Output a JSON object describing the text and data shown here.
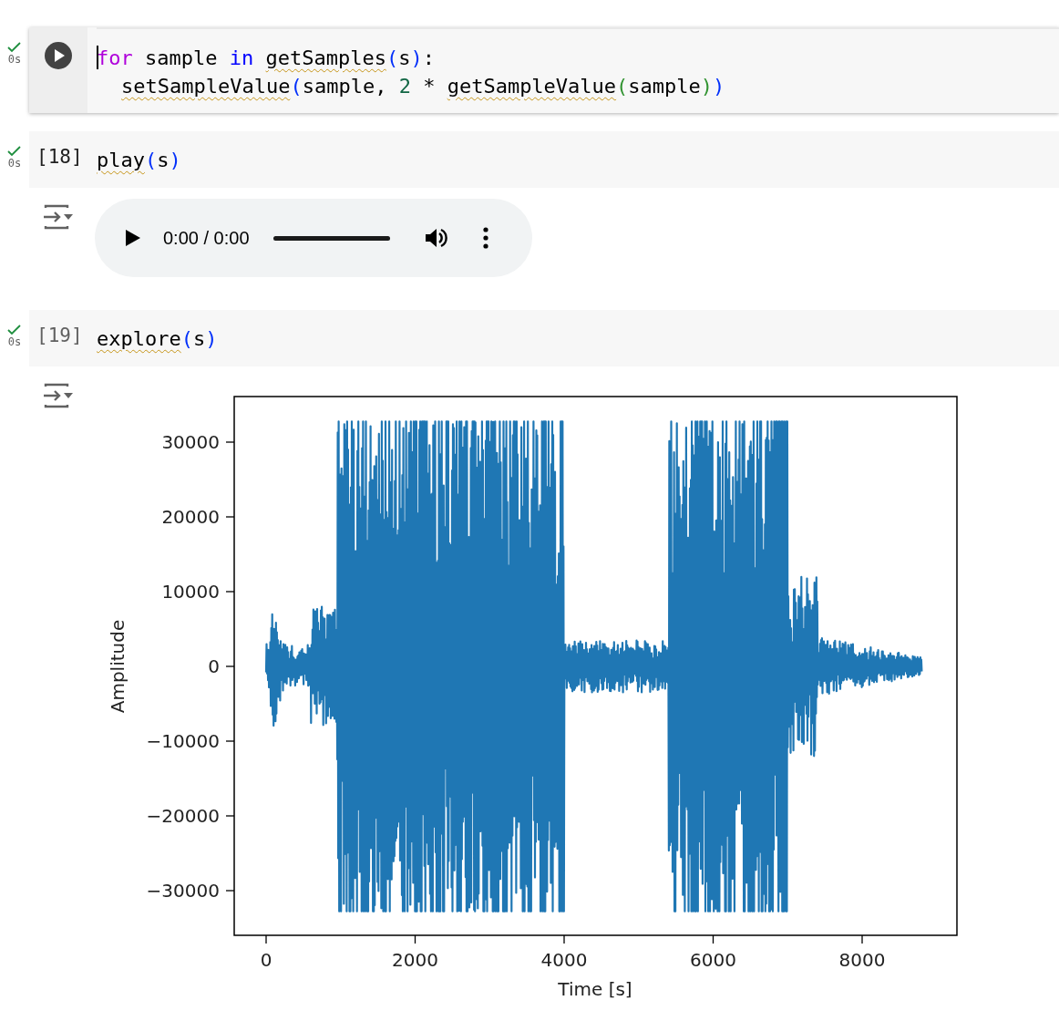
{
  "cells": [
    {
      "kind": "editing",
      "status": "0s",
      "done": true,
      "lines": [
        {
          "indented": false,
          "tokens": [
            {
              "t": "for",
              "kind": "kw"
            },
            {
              "t": " sample ",
              "kind": "plain"
            },
            {
              "t": "in ",
              "kind": "op"
            },
            {
              "t": "getSamples",
              "kind": "warn"
            },
            {
              "t": "(",
              "kind": "b1"
            },
            {
              "t": "s",
              "kind": "plain"
            },
            {
              "t": ")",
              "kind": "b1"
            },
            {
              "t": ":",
              "kind": "plain"
            }
          ]
        },
        {
          "indented": true,
          "tokens": [
            {
              "t": "setSampleValue",
              "kind": "warn"
            },
            {
              "t": "(",
              "kind": "b1"
            },
            {
              "t": "sample, ",
              "kind": "plain"
            },
            {
              "t": "2",
              "kind": "num"
            },
            {
              "t": " * ",
              "kind": "plain"
            },
            {
              "t": "getSampleValue",
              "kind": "warn"
            },
            {
              "t": "(",
              "kind": "b2"
            },
            {
              "t": "sample",
              "kind": "plain"
            },
            {
              "t": ")",
              "kind": "b2"
            },
            {
              "t": ")",
              "kind": "b1"
            }
          ]
        }
      ]
    },
    {
      "kind": "plain",
      "status": "0s",
      "done": true,
      "count": "[18]",
      "lines": [
        {
          "indented": false,
          "tokens": [
            {
              "t": "play",
              "kind": "warn"
            },
            {
              "t": "(",
              "kind": "b1"
            },
            {
              "t": "s",
              "kind": "plain"
            },
            {
              "t": ")",
              "kind": "b1"
            }
          ]
        }
      ],
      "output": {
        "kind": "audio",
        "time": "0:00 / 0:00",
        "level": 1
      }
    },
    {
      "kind": "hover",
      "status": "0s",
      "done": true,
      "count": "[19]",
      "lines": [
        {
          "indented": false,
          "tokens": [
            {
              "t": "explore",
              "kind": "warn"
            },
            {
              "t": "(",
              "kind": "b1"
            },
            {
              "t": "s",
              "kind": "plain"
            },
            {
              "t": ")",
              "kind": "b1"
            }
          ]
        }
      ],
      "output": {
        "kind": "plot",
        "xlabel": "Time [s]",
        "ylabel": "Amplitude",
        "xticks": [
          "0",
          "2000",
          "4000",
          "6000",
          "8000"
        ],
        "yticks": [
          "30000",
          "20000",
          "10000",
          "0",
          "−10000",
          "−20000",
          "−30000"
        ]
      }
    }
  ]
}
